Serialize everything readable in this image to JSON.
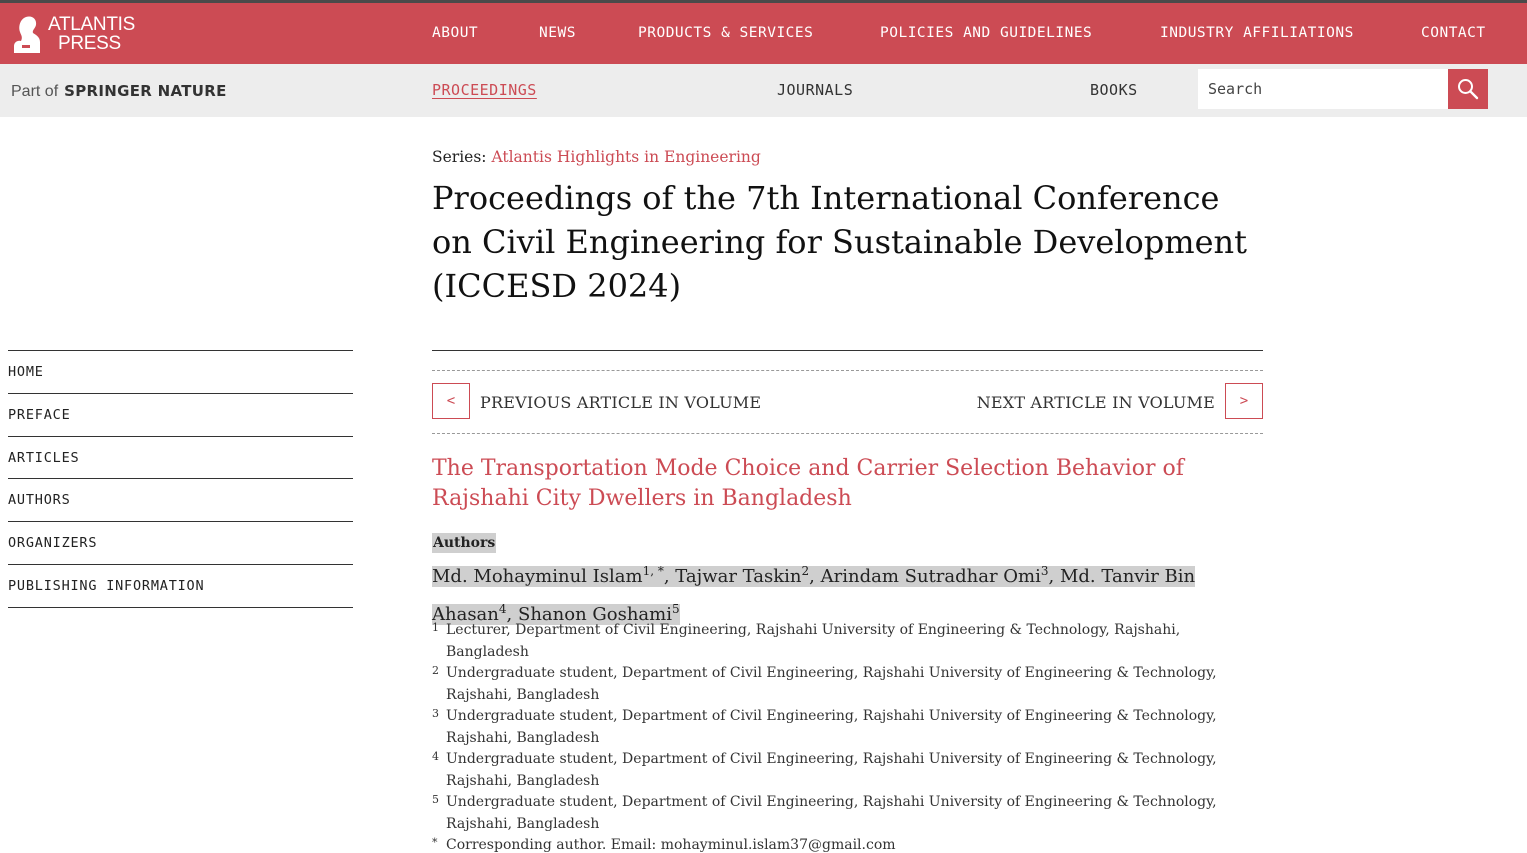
{
  "brand": {
    "line1": "ATLANTIS",
    "line2": "PRESS",
    "part_of": "Part of",
    "parent": "SPRINGER NATURE"
  },
  "colors": {
    "accent": "#cc4b54",
    "subbar": "#ededed",
    "highlight": "#cfcfcf"
  },
  "topnav": [
    {
      "label": "ABOUT"
    },
    {
      "label": "NEWS"
    },
    {
      "label": "PRODUCTS & SERVICES"
    },
    {
      "label": "POLICIES AND GUIDELINES"
    },
    {
      "label": "INDUSTRY AFFILIATIONS"
    },
    {
      "label": "CONTACT"
    }
  ],
  "subnav": [
    {
      "label": "PROCEEDINGS",
      "active": true
    },
    {
      "label": "JOURNALS"
    },
    {
      "label": "BOOKS"
    }
  ],
  "search": {
    "placeholder": "Search",
    "icon": "search-icon"
  },
  "sidebar": [
    {
      "label": "HOME"
    },
    {
      "label": "PREFACE"
    },
    {
      "label": "ARTICLES"
    },
    {
      "label": "AUTHORS"
    },
    {
      "label": "ORGANIZERS"
    },
    {
      "label": "PUBLISHING INFORMATION"
    }
  ],
  "series": {
    "label": "Series:",
    "name": "Atlantis Highlights in Engineering"
  },
  "proceedings_title": "Proceedings of the 7th International Conference on Civil Engineering for Sustainable Development (ICCESD 2024)",
  "article_nav": {
    "prev_symbol": "<",
    "prev_label": "PREVIOUS ARTICLE IN VOLUME",
    "next_label": "NEXT ARTICLE IN VOLUME",
    "next_symbol": ">"
  },
  "article": {
    "title": "The Transportation Mode Choice and Carrier Selection Behavior of Rajshahi City Dwellers in Bangladesh",
    "authors_label": "Authors",
    "authors": [
      {
        "name": "Md. Mohayminul Islam",
        "sup": "1, *"
      },
      {
        "name": "Tajwar Taskin",
        "sup": "2"
      },
      {
        "name": "Arindam Sutradhar Omi",
        "sup": "3"
      },
      {
        "name": "Md. Tanvir Bin Ahasan",
        "sup": "4"
      },
      {
        "name": "Shanon Goshami",
        "sup": "5"
      }
    ],
    "separator": ", ",
    "affiliations": [
      {
        "num": "1",
        "text": "Lecturer, Department of Civil Engineering, Rajshahi University of Engineering & Technology, Rajshahi, Bangladesh"
      },
      {
        "num": "2",
        "text": "Undergraduate student, Department of Civil Engineering, Rajshahi University of Engineering & Technology, Rajshahi, Bangladesh"
      },
      {
        "num": "3",
        "text": "Undergraduate student, Department of Civil Engineering, Rajshahi University of Engineering & Technology, Rajshahi, Bangladesh"
      },
      {
        "num": "4",
        "text": "Undergraduate student, Department of Civil Engineering, Rajshahi University of Engineering & Technology, Rajshahi, Bangladesh"
      },
      {
        "num": "5",
        "text": "Undergraduate student, Department of Civil Engineering, Rajshahi University of Engineering & Technology, Rajshahi, Bangladesh"
      },
      {
        "num": "*",
        "text": "Corresponding author. Email: mohayminul.islam37@gmail.com"
      }
    ]
  }
}
